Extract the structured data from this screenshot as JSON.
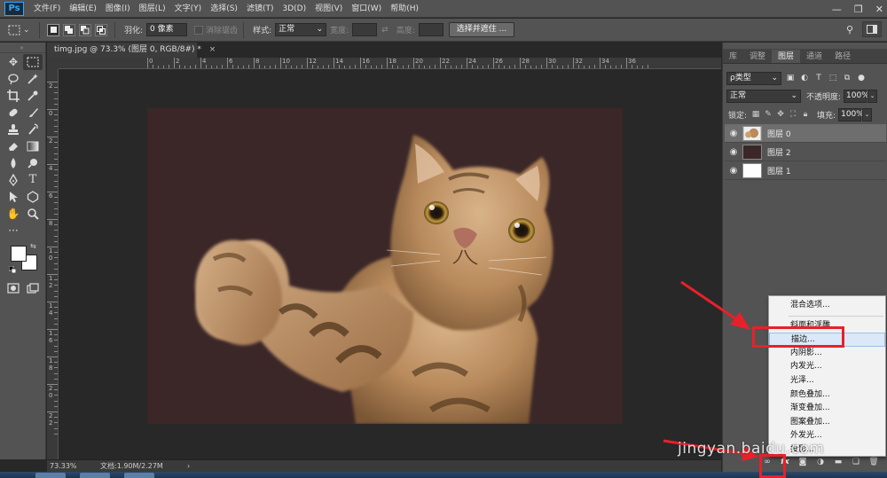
{
  "app": {
    "logo": "Ps"
  },
  "menu": [
    "文件(F)",
    "编辑(E)",
    "图像(I)",
    "图层(L)",
    "文字(Y)",
    "选择(S)",
    "滤镜(T)",
    "3D(D)",
    "视图(V)",
    "窗口(W)",
    "帮助(H)"
  ],
  "window_controls": {
    "minimize": "—",
    "restore": "❐",
    "close": "✕"
  },
  "options": {
    "feather_label": "羽化:",
    "feather_value": "0 像素",
    "antialias_label": "消除锯齿",
    "style_label": "样式:",
    "style_value": "正常",
    "width_label": "宽度:",
    "height_label": "高度:",
    "select_mask_button": "选择并遮住 ..."
  },
  "document": {
    "tab_title": "timg.jpg @ 73.3% (图层 0, RGB/8#) *",
    "tab_close": "×",
    "zoom": "73.33%",
    "doc_size": "文档:1.90M/2.27M",
    "status_arrow": "›",
    "artboard_color": "#3b2728"
  },
  "rulers": {
    "h_labels": [
      "0",
      "2",
      "4",
      "6",
      "8",
      "10",
      "12",
      "14",
      "16",
      "18",
      "20",
      "22",
      "24",
      "26",
      "28",
      "30",
      "32",
      "34",
      "36"
    ],
    "v_labels": [
      "2",
      "0",
      "2",
      "4",
      "6",
      "8",
      "1 0",
      "1 2",
      "1 4",
      "1 6",
      "1 8",
      "2 0",
      "2 2"
    ]
  },
  "panels": {
    "tabs": [
      "库",
      "调整",
      "图层",
      "通道",
      "路径"
    ],
    "active_tab": 2,
    "filter_kind": "ρ类型",
    "blend_mode": "正常",
    "opacity_label": "不透明度:",
    "opacity_value": "100%",
    "lock_label": "锁定:",
    "fill_label": "填充:",
    "fill_value": "100%",
    "layers": [
      {
        "name": "图层 0",
        "thumb": "cat",
        "selected": true
      },
      {
        "name": "图层 2",
        "thumb": "#3b2728",
        "selected": false
      },
      {
        "name": "图层 1",
        "thumb": "#ffffff",
        "selected": false
      }
    ]
  },
  "fx_menu": {
    "items": [
      {
        "label": "混合选项...",
        "sep_after": true
      },
      {
        "label": "斜面和浮雕...",
        "sep_after": false
      },
      {
        "label": "描边...",
        "highlight": true
      },
      {
        "label": "内阴影...",
        "sep_after": false
      },
      {
        "label": "内发光...",
        "sep_after": false
      },
      {
        "label": "光泽...",
        "sep_after": false
      },
      {
        "label": "颜色叠加...",
        "sep_after": false
      },
      {
        "label": "渐变叠加...",
        "sep_after": false
      },
      {
        "label": "图案叠加...",
        "sep_after": false
      },
      {
        "label": "外发光...",
        "sep_after": false
      },
      {
        "label": "投影...",
        "sep_after": false
      }
    ]
  },
  "watermark": "jingyan.baidu.com",
  "colors": {
    "highlight_red": "#e8202a",
    "ps_blue": "#31a8ff"
  }
}
